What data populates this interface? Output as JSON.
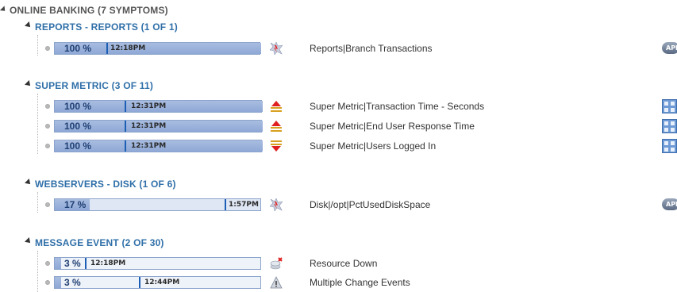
{
  "root": {
    "title": "ONLINE BANKING   (7 SYMPTOMS)"
  },
  "groups": [
    {
      "title": "REPORTS - REPORTS   (1 OF 1)",
      "rows": [
        {
          "percent": "100 %",
          "progress": 1.0,
          "time": "12:18PM",
          "description": "Reports|Branch Transactions",
          "icon": "alert-burst-icon",
          "right_icon": "api-icon",
          "right_label": "API"
        }
      ]
    },
    {
      "title": "SUPER METRIC   (3 OF 11)",
      "rows": [
        {
          "percent": "100 %",
          "progress": 1.0,
          "time": "12:31PM",
          "description": "Super Metric|Transaction Time - Seconds",
          "icon": "trend-up-icon",
          "right_icon": "calculator-icon"
        },
        {
          "percent": "100 %",
          "progress": 1.0,
          "time": "12:31PM",
          "description": "Super Metric|End User Response Time",
          "icon": "trend-up-icon",
          "right_icon": "calculator-icon"
        },
        {
          "percent": "100 %",
          "progress": 1.0,
          "time": "12:31PM",
          "description": "Super Metric|Users Logged In",
          "icon": "trend-down-icon",
          "right_icon": "calculator-icon"
        }
      ]
    },
    {
      "title": "WEBSERVERS - DISK   (1 OF 6)",
      "rows": [
        {
          "percent": "17 %",
          "progress": 0.17,
          "time": "1:57PM",
          "description": "Disk|/opt|PctUsedDiskSpace",
          "icon": "alert-burst-icon",
          "right_icon": "api-icon",
          "right_label": "API"
        }
      ]
    },
    {
      "title": "MESSAGE EVENT   (2 OF 30)",
      "rows": [
        {
          "percent": "3 %",
          "progress": 0.03,
          "time": "12:18PM",
          "description": "Resource Down",
          "icon": "resource-down-icon"
        },
        {
          "percent": "3 %",
          "progress": 0.03,
          "time": "12:44PM",
          "description": "Multiple Change Events",
          "icon": "warning-triangle-icon"
        }
      ]
    }
  ],
  "colors": {
    "group_title": "#2f6fa8",
    "bar_fill": "#8ea8d6",
    "bar_bg": "#dfe7f4",
    "marker": "#1d5fb4"
  }
}
